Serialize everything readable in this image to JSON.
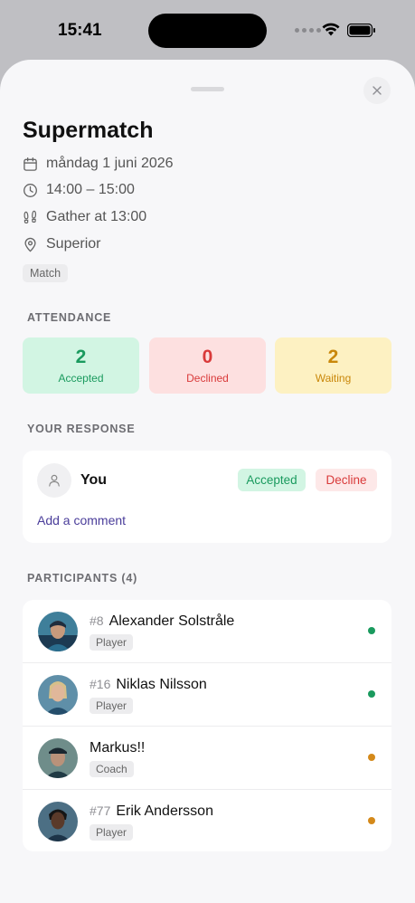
{
  "status_bar": {
    "time": "15:41"
  },
  "event": {
    "title": "Supermatch",
    "date": "måndag 1 juni 2026",
    "time_range": "14:00 – 15:00",
    "gather": "Gather at 13:00",
    "location": "Superior",
    "tag": "Match"
  },
  "attendance": {
    "section_label": "ATTENDANCE",
    "accepted": {
      "count": "2",
      "label": "Accepted",
      "color": "#1a9a5e"
    },
    "declined": {
      "count": "0",
      "label": "Declined",
      "color": "#d93a3a"
    },
    "waiting": {
      "count": "2",
      "label": "Waiting",
      "color": "#c9870a"
    }
  },
  "response": {
    "section_label": "YOUR RESPONSE",
    "user_label": "You",
    "accepted_label": "Accepted",
    "decline_label": "Decline",
    "add_comment": "Add a comment"
  },
  "participants": {
    "section_label": "PARTICIPANTS (4)",
    "items": [
      {
        "number": "#8",
        "name": "Alexander Solstråle",
        "role": "Player",
        "status": "accepted",
        "status_color": "#1a9a5e"
      },
      {
        "number": "#16",
        "name": "Niklas Nilsson",
        "role": "Player",
        "status": "accepted",
        "status_color": "#1a9a5e"
      },
      {
        "number": "",
        "name": "Markus!!",
        "role": "Coach",
        "status": "waiting",
        "status_color": "#d4891a"
      },
      {
        "number": "#77",
        "name": "Erik Andersson",
        "role": "Player",
        "status": "waiting",
        "status_color": "#d4891a"
      }
    ]
  }
}
